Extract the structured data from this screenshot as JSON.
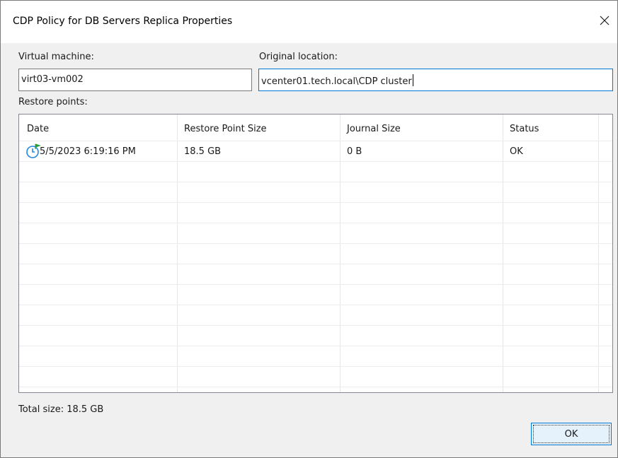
{
  "dialog": {
    "title": "CDP Policy for DB Servers Replica Properties",
    "close_icon": "close-icon"
  },
  "form": {
    "vm_label": "Virtual machine:",
    "vm_value": "virt03-vm002",
    "location_label": "Original location:",
    "location_value": "vcenter01.tech.local\\CDP cluster",
    "restore_points_label": "Restore points:"
  },
  "table": {
    "columns": [
      "Date",
      "Restore Point Size",
      "Journal Size",
      "Status"
    ],
    "rows": [
      {
        "icon": "restore-point-clock-icon",
        "date": "5/5/2023 6:19:16 PM",
        "size": "18.5 GB",
        "journal": "0 B",
        "status": "OK"
      }
    ]
  },
  "footer": {
    "total_size": "Total size: 18.5 GB",
    "ok_label": "OK"
  },
  "colors": {
    "accent": "#0078d7",
    "dialog_bg": "#f0f0f0",
    "icon_blue": "#1e88e5",
    "icon_green": "#2e9a3e"
  }
}
